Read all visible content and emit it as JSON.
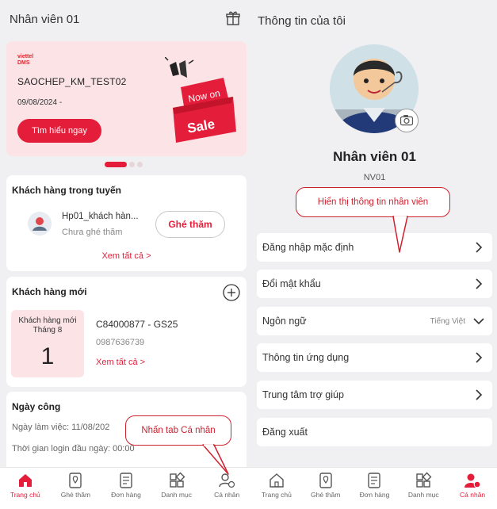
{
  "left": {
    "header_title": "Nhân viên 01",
    "banner": {
      "brand_line1": "viettel",
      "brand_line2": "DMS",
      "promo_title": "SAOCHEP_KM_TEST02",
      "promo_date": "09/08/2024 -",
      "cta_label": "Tìm hiểu ngay",
      "art_text_1": "Now on",
      "art_text_2": "Sale"
    },
    "route_customers": {
      "title": "Khách hàng trong tuyến",
      "customer_name": "Hp01_khách hàn...",
      "customer_status": "Chưa ghé thăm",
      "visit_label": "Ghé thăm",
      "see_all": "Xem tất cả >"
    },
    "new_customers": {
      "title": "Khách hàng mới",
      "stat_label": "Khách hàng mới Tháng 8",
      "stat_value": "1",
      "code": "C84000877 - GS25",
      "phone": "0987636739",
      "see_all": "Xem tất cả >"
    },
    "workday": {
      "title": "Ngày công",
      "work_date": "Ngày làm việc: 11/08/202",
      "login_time": "Thời gian login đầu ngày: 00:00"
    },
    "callout": "Nhấn tab Cá nhân",
    "nav": [
      {
        "label": "Trang chủ",
        "icon": "home-icon",
        "active": true
      },
      {
        "label": "Ghé thăm",
        "icon": "visit-icon",
        "active": false
      },
      {
        "label": "Đơn hàng",
        "icon": "order-icon",
        "active": false
      },
      {
        "label": "Danh mục",
        "icon": "category-icon",
        "active": false
      },
      {
        "label": "Cá nhân",
        "icon": "profile-icon",
        "active": false
      }
    ]
  },
  "right": {
    "header_title": "Thông tin của tôi",
    "profile_name": "Nhân viên 01",
    "profile_code": "NV01",
    "callout": "Hiển thị thông tin nhân viên",
    "menu": [
      {
        "label": "Đăng nhập mặc định",
        "value": ""
      },
      {
        "label": "Đổi mật khẩu",
        "value": ""
      },
      {
        "label": "Ngôn ngữ",
        "value": "Tiếng Việt"
      },
      {
        "label": "Thông tin ứng dụng",
        "value": ""
      },
      {
        "label": "Trung tâm trợ giúp",
        "value": ""
      },
      {
        "label": "Đăng xuất",
        "value": ""
      }
    ],
    "nav": [
      {
        "label": "Trang chủ",
        "icon": "home-icon",
        "active": false
      },
      {
        "label": "Ghé thăm",
        "icon": "visit-icon",
        "active": false
      },
      {
        "label": "Đơn hàng",
        "icon": "order-icon",
        "active": false
      },
      {
        "label": "Danh mục",
        "icon": "category-icon",
        "active": false
      },
      {
        "label": "Cá nhân",
        "icon": "profile-icon",
        "active": true
      }
    ]
  },
  "colors": {
    "accent": "#e41e3a",
    "banner_bg": "#fbe3e6",
    "callout_border": "#d0212f"
  }
}
